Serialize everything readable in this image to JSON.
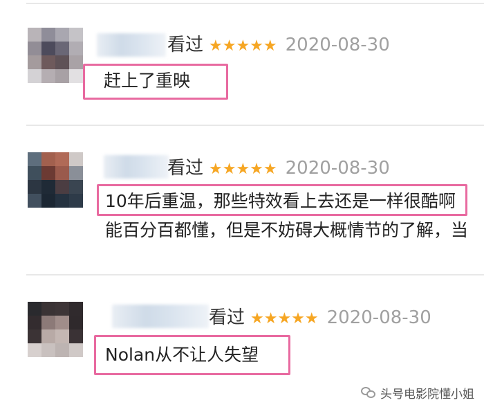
{
  "reviews": [
    {
      "status": "看过",
      "stars": "★★★★★",
      "date": "2020-08-30",
      "comment": "赶上了重映"
    },
    {
      "status": "看过",
      "stars": "★★★★★",
      "date": "2020-08-30",
      "comment_line1": "10年后重温，那些特效看上去还是一样很酷啊",
      "comment_line2": "能百分百都懂，但是不妨碍大概情节的了解，当"
    },
    {
      "status": "看过",
      "stars": "★★★★★",
      "date": "2020-08-30",
      "comment": "Nolan从不让人失望"
    }
  ],
  "watermark": {
    "text": "头号电影院懂小姐",
    "icon": "wechat-icon"
  },
  "colors": {
    "highlight": "#e86aa0",
    "star": "#f6a623",
    "date": "#a0a0a0"
  }
}
